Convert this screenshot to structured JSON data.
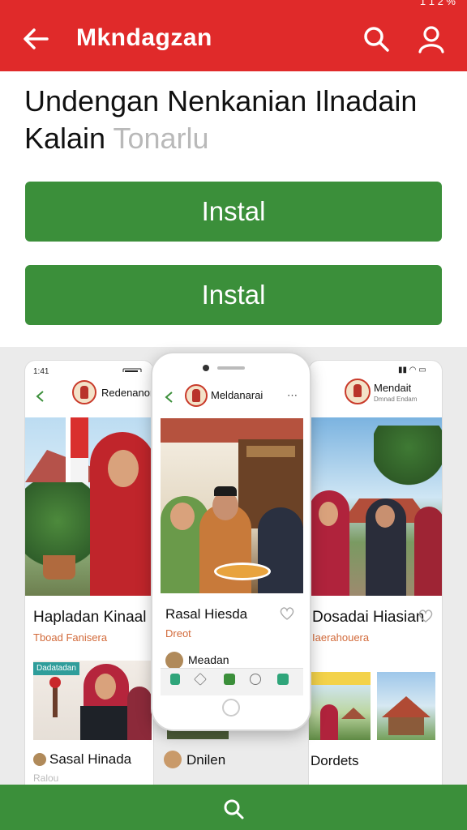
{
  "app_bar": {
    "title": "Mkndagzan",
    "status_right": "1 1 2 %"
  },
  "heading": {
    "main": "Undengan Nenkanian Ilnadain Kalain",
    "faded": "Tonarlu"
  },
  "buttons": {
    "install_1": "Instal",
    "install_2": "Instal"
  },
  "gallery": {
    "left": {
      "time": "1:41",
      "name": "Redenanon",
      "title": "Hapladan Kinaal",
      "sub": "Tboad Fanisera",
      "caption": "Dadatadan",
      "bottom_label": "Sasal Hinada",
      "bottom_faded": "Ralou"
    },
    "mid": {
      "name": "Meldanarai",
      "title": "Rasal Hiesda",
      "sub": "Dreot",
      "user": "Meadan"
    },
    "right": {
      "name": "Mendait",
      "name_sub": "Dmnad Endam",
      "title": "Dosadai Hiasian",
      "sub": "Iaerahouera",
      "bottom_mid": "Dnilen",
      "bottom_right": "Dordets"
    }
  },
  "colors": {
    "primary_red": "#e02a2a",
    "primary_green": "#3b8f3a"
  }
}
